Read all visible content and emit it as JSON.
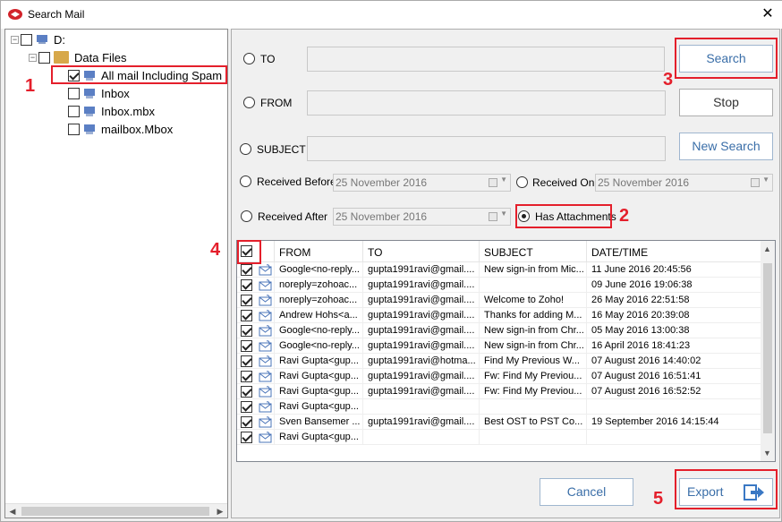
{
  "window": {
    "title": "Search Mail",
    "close": "✕"
  },
  "tree": {
    "drive": "D:",
    "folder": "Data Files",
    "items": [
      {
        "label": "All mail Including Spam",
        "checked": true
      },
      {
        "label": "Inbox",
        "checked": false
      },
      {
        "label": "Inbox.mbx",
        "checked": false
      },
      {
        "label": "mailbox.Mbox",
        "checked": false
      }
    ]
  },
  "filters": {
    "to_label": "TO",
    "from_label": "FROM",
    "subject_label": "SUBJECT",
    "received_before_label": "Received Before",
    "received_before_value": "25 November 2016",
    "received_on_label": "Received On",
    "received_on_value": "25 November 2016",
    "received_after_label": "Received After",
    "received_after_value": "25 November 2016",
    "has_attachments_label": "Has Attachments"
  },
  "buttons": {
    "search": "Search",
    "stop": "Stop",
    "new_search": "New Search",
    "cancel": "Cancel",
    "export": "Export"
  },
  "grid": {
    "columns": [
      "FROM",
      "TO",
      "SUBJECT",
      "DATE/TIME"
    ],
    "rows": [
      [
        "Google<no-reply...",
        "gupta1991ravi@gmail....",
        "New sign-in from Mic...",
        "11 June 2016 20:45:56"
      ],
      [
        "noreply=zohoac...",
        "gupta1991ravi@gmail....",
        "",
        "09 June 2016 19:06:38"
      ],
      [
        "noreply=zohoac...",
        "gupta1991ravi@gmail....",
        "Welcome to Zoho!",
        "26 May 2016 22:51:58"
      ],
      [
        "Andrew Hohs<a...",
        "gupta1991ravi@gmail....",
        "Thanks for adding M...",
        "16 May 2016 20:39:08"
      ],
      [
        "Google<no-reply...",
        "gupta1991ravi@gmail....",
        "New sign-in from Chr...",
        "05 May 2016 13:00:38"
      ],
      [
        "Google<no-reply...",
        "gupta1991ravi@gmail....",
        "New sign-in from Chr...",
        "16 April 2016 18:41:23"
      ],
      [
        "Ravi Gupta<gup...",
        "gupta1991ravi@hotma...",
        "Find My Previous W...",
        "07 August 2016 14:40:02"
      ],
      [
        "Ravi Gupta<gup...",
        "gupta1991ravi@gmail....",
        "Fw: Find My Previou...",
        "07 August 2016 16:51:41"
      ],
      [
        "Ravi Gupta<gup...",
        "gupta1991ravi@gmail....",
        "Fw: Find My Previou...",
        "07 August 2016 16:52:52"
      ],
      [
        "Ravi Gupta<gup...",
        "",
        "",
        ""
      ],
      [
        "Sven Bansemer ...",
        "gupta1991ravi@gmail....",
        "Best OST to PST Co...",
        "19 September 2016 14:15:44"
      ],
      [
        "Ravi Gupta<gup...",
        "",
        "",
        ""
      ]
    ]
  },
  "annotations": [
    "1",
    "2",
    "3",
    "4",
    "5"
  ],
  "colors": {
    "annotation": "#e41f2b",
    "accent": "#3a6ea8"
  }
}
